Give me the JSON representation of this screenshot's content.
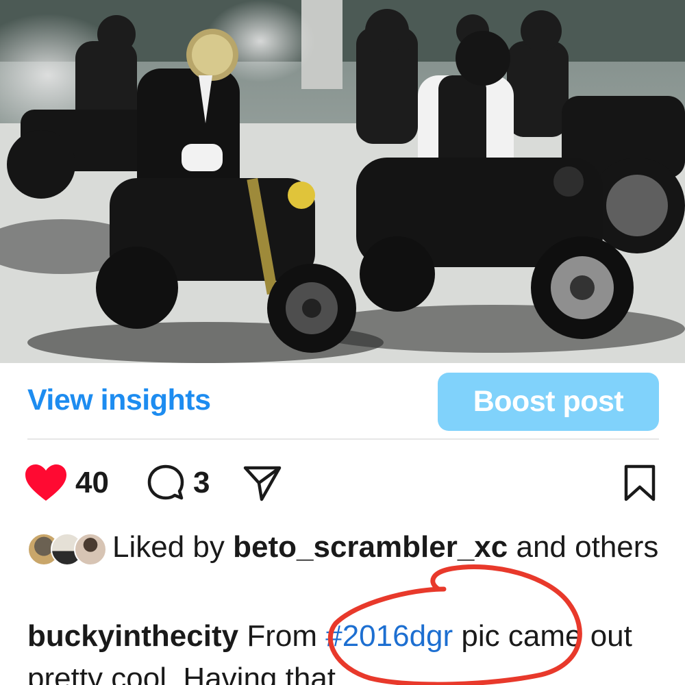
{
  "post": {
    "image_alt": "Group of motorcycle riders in suits and helmets",
    "view_insights_label": "View insights",
    "boost_post_label": "Boost post",
    "like_count": "40",
    "comment_count": "3",
    "liked_by_prefix": "Liked by",
    "liked_by_user": "beto_scrambler_xc",
    "liked_by_suffix": "and others",
    "caption_user": "buckyinthecity",
    "caption_pre": "From",
    "caption_hashtag": "#2016dgr",
    "caption_post": "pic came out pretty cool. Having that"
  },
  "icons": {
    "like": "heart-icon",
    "comment": "comment-bubble-icon",
    "share": "paper-plane-icon",
    "save": "bookmark-icon"
  },
  "colors": {
    "link_blue": "#1d8cf0",
    "boost_bg": "#80d2fb",
    "heart_red": "#ff0a32",
    "hashtag_blue": "#1d6fd1",
    "annotation_red": "#e8392b"
  }
}
